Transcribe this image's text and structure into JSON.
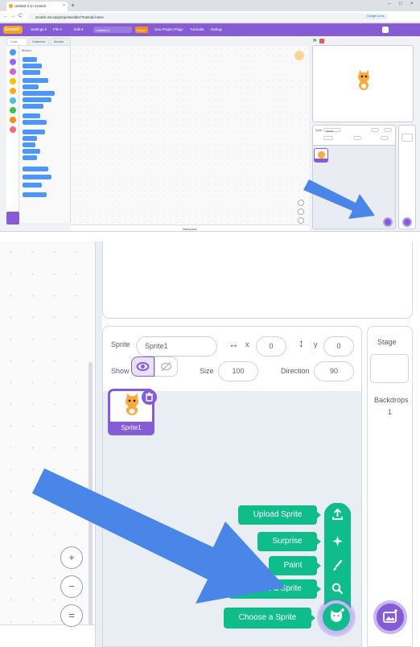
{
  "browser": {
    "tab_title": "Untitled-3 on Scratch",
    "url": "scratch.mit.edu/projects/editor/?tutorial=home",
    "tab_close": "×",
    "new_tab": "+",
    "nav_back": "←",
    "nav_forward": "→",
    "reload": "C",
    "window_min": "–",
    "window_max": "□",
    "window_close": "×",
    "sign_in_chip": "Google Lens"
  },
  "editor": {
    "logo": "Scratch",
    "menu": [
      "Settings ▾",
      "File ▾",
      "Edit ▾"
    ],
    "project_title": "Untitled-3",
    "share": "Share",
    "see_project_page": "See Project Page",
    "tutorials": "Tutorials",
    "debug": "Debug",
    "tabs": [
      "Code",
      "Costumes",
      "Sounds"
    ],
    "category_colors": [
      "#4c97ff",
      "#9966ff",
      "#cf63cf",
      "#ffbf00",
      "#ffab19",
      "#4cbfe6",
      "#40bf4a",
      "#ff8c1a",
      "#ff6680"
    ],
    "palette_header": "Motion",
    "backpack": "Backpack",
    "green_flag": "⚑",
    "mini_sprite_label": "Sprite",
    "mini_sprite_name": "Sprite1"
  },
  "zoom": {
    "sprite_label": "Sprite",
    "sprite_name": "Sprite1",
    "x_label": "x",
    "x_value": "0",
    "y_label": "y",
    "y_value": "0",
    "show_label": "Show",
    "size_label": "Size",
    "size_value": "100",
    "direction_label": "Direction",
    "direction_value": "90",
    "stage_label": "Stage",
    "backdrops_label": "Backdrops",
    "backdrops_count": "1",
    "thumb_name": "Sprite1",
    "sprite_menu": {
      "upload": "Upload Sprite",
      "surprise": "Surprise",
      "paint": "Paint",
      "choose_item": "Choose a Sprite",
      "choose_main": "Choose a Sprite"
    },
    "zoom_in": "+",
    "zoom_out": "−",
    "zoom_reset": "="
  },
  "colors": {
    "scratch_purple": "#855cd6",
    "menu_green": "#0fbd8c",
    "arrow_blue": "#4a86e8",
    "scratch_orange": "#f9a21c"
  }
}
